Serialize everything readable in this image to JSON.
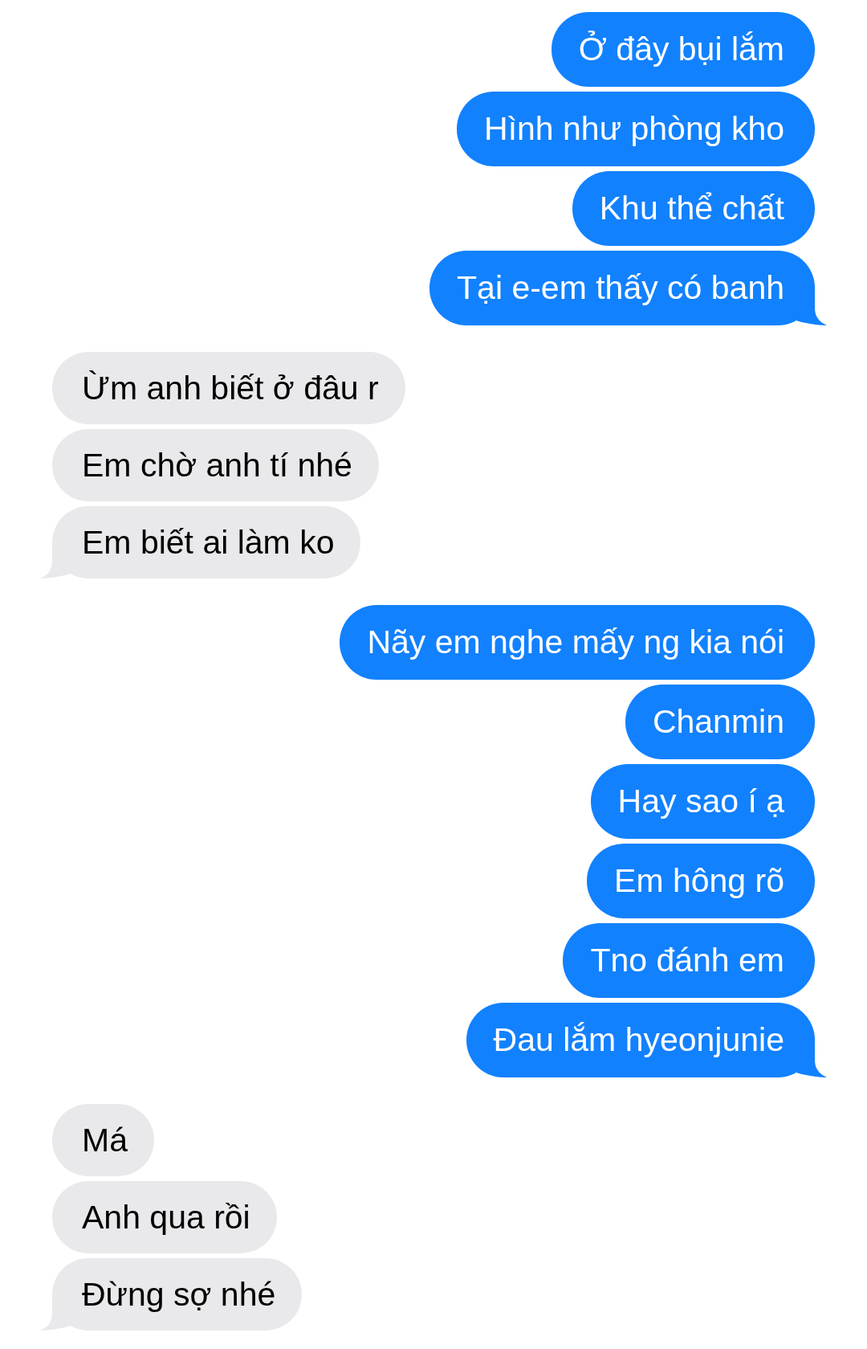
{
  "conversation": [
    {
      "kind": "sent",
      "messages": [
        "Ở đây bụi lắm",
        "Hình như phòng kho",
        "Khu thể chất",
        "Tại e-em thấy có banh"
      ]
    },
    {
      "kind": "received",
      "messages": [
        "Ừm anh biết ở đâu r",
        "Em chờ anh tí nhé",
        "Em biết ai làm ko"
      ]
    },
    {
      "kind": "sent",
      "messages": [
        "Nãy em nghe mấy ng kia nói",
        "Chanmin",
        "Hay sao í ạ",
        "Em hông rõ",
        "Tno đánh em",
        "Đau lắm hyeonjunie"
      ]
    },
    {
      "kind": "received",
      "messages": [
        "Má",
        "Anh qua rồi",
        "Đừng sợ nhé"
      ]
    }
  ]
}
